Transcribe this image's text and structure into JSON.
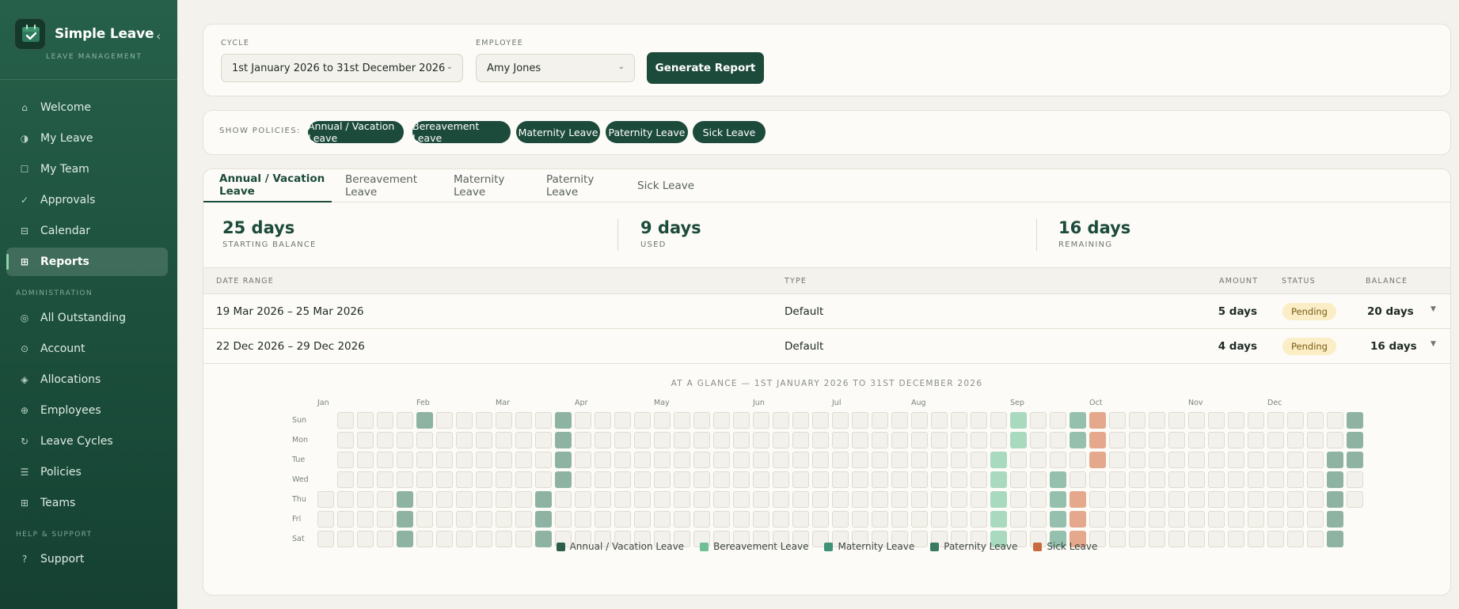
{
  "sidebar": {
    "brand": "Simple Leave",
    "subtitle": "LEAVE MANAGEMENT",
    "main_items": [
      {
        "label": "Welcome",
        "icon": "home-icon"
      },
      {
        "label": "My Leave",
        "icon": "half-circle-icon"
      },
      {
        "label": "My Team",
        "icon": "square-icon"
      },
      {
        "label": "Approvals",
        "icon": "check-icon"
      },
      {
        "label": "Calendar",
        "icon": "calendar-icon"
      },
      {
        "label": "Reports",
        "icon": "grid-icon",
        "active": true
      }
    ],
    "admin_label": "ADMINISTRATION",
    "admin_items": [
      {
        "label": "All Outstanding",
        "icon": "target-icon"
      },
      {
        "label": "Account",
        "icon": "circle-dot-icon"
      },
      {
        "label": "Allocations",
        "icon": "diamond-icon"
      },
      {
        "label": "Employees",
        "icon": "plus-circle-icon"
      },
      {
        "label": "Leave Cycles",
        "icon": "cycle-icon"
      },
      {
        "label": "Policies",
        "icon": "list-icon"
      },
      {
        "label": "Teams",
        "icon": "grid-plus-icon"
      }
    ],
    "help_label": "HELP & SUPPORT",
    "help_items": [
      {
        "label": "Support",
        "icon": "question-icon"
      }
    ]
  },
  "filters": {
    "cycle_label": "CYCLE",
    "cycle_value": "1st January 2026 to 31st December 2026",
    "employee_label": "EMPLOYEE",
    "employee_value": "Amy Jones",
    "generate_label": "Generate Report"
  },
  "policies": {
    "label": "SHOW POLICIES:",
    "items": [
      "Annual / Vacation Leave",
      "Bereavement Leave",
      "Maternity Leave",
      "Paternity Leave",
      "Sick Leave"
    ]
  },
  "tabs": [
    "Annual / Vacation Leave",
    "Bereavement Leave",
    "Maternity Leave",
    "Paternity Leave",
    "Sick Leave"
  ],
  "stats": [
    {
      "value": "25 days",
      "label": "STARTING BALANCE"
    },
    {
      "value": "9 days",
      "label": "USED"
    },
    {
      "value": "16 days",
      "label": "REMAINING"
    }
  ],
  "table": {
    "headers": {
      "date_range": "DATE RANGE",
      "type": "TYPE",
      "amount": "AMOUNT",
      "status": "STATUS",
      "balance": "BALANCE"
    },
    "rows": [
      {
        "date_range": "19 Mar 2026 – 25 Mar 2026",
        "type": "Default",
        "amount": "5 days",
        "status": "Pending",
        "balance": "20 days"
      },
      {
        "date_range": "22 Dec 2026 – 29 Dec 2026",
        "type": "Default",
        "amount": "4 days",
        "status": "Pending",
        "balance": "16 days"
      }
    ]
  },
  "glance": {
    "title": "AT A GLANCE — 1ST JANUARY 2026 TO 31ST DECEMBER 2026",
    "months": [
      "Jan",
      "Feb",
      "Mar",
      "Apr",
      "May",
      "Jun",
      "Jul",
      "Aug",
      "Sep",
      "Oct",
      "Nov",
      "Dec"
    ],
    "days": [
      "Sun",
      "Mon",
      "Tue",
      "Wed",
      "Thu",
      "Fri",
      "Sat"
    ],
    "legend": [
      {
        "label": "Annual / Vacation Leave",
        "color": "#2d5e4b"
      },
      {
        "label": "Bereavement Leave",
        "color": "#6ebf95"
      },
      {
        "label": "Maternity Leave",
        "color": "#3f9278"
      },
      {
        "label": "Paternity Leave",
        "color": "#3a7a61"
      },
      {
        "label": "Sick Leave",
        "color": "#c76b3f"
      }
    ],
    "leave_days": {
      "annual": [
        "2026-01-29",
        "2026-01-30",
        "2026-01-31",
        "2026-02-01",
        "2026-03-19",
        "2026-03-20",
        "2026-03-21",
        "2026-03-22",
        "2026-03-23",
        "2026-03-24",
        "2026-03-25",
        "2026-12-22",
        "2026-12-23",
        "2026-12-24",
        "2026-12-25",
        "2026-12-26",
        "2026-12-27",
        "2026-12-28",
        "2026-12-29"
      ],
      "bereavement": [
        "2026-08-25",
        "2026-08-26",
        "2026-08-27",
        "2026-08-28",
        "2026-08-29",
        "2026-08-30",
        "2026-08-31"
      ],
      "maternity": [
        "2026-09-16",
        "2026-09-17",
        "2026-09-18",
        "2026-09-19",
        "2026-09-20",
        "2026-09-21"
      ],
      "sick": [
        "2026-09-24",
        "2026-09-25",
        "2026-09-26",
        "2026-09-27",
        "2026-09-28",
        "2026-09-29"
      ]
    }
  },
  "colors": {
    "accent": "#1d4b3b",
    "annual_cell": "#8fb3a3",
    "bereavement_cell": "#a9d9bf",
    "maternity_cell": "#95c0ad",
    "sick_cell": "#e5a88c"
  }
}
